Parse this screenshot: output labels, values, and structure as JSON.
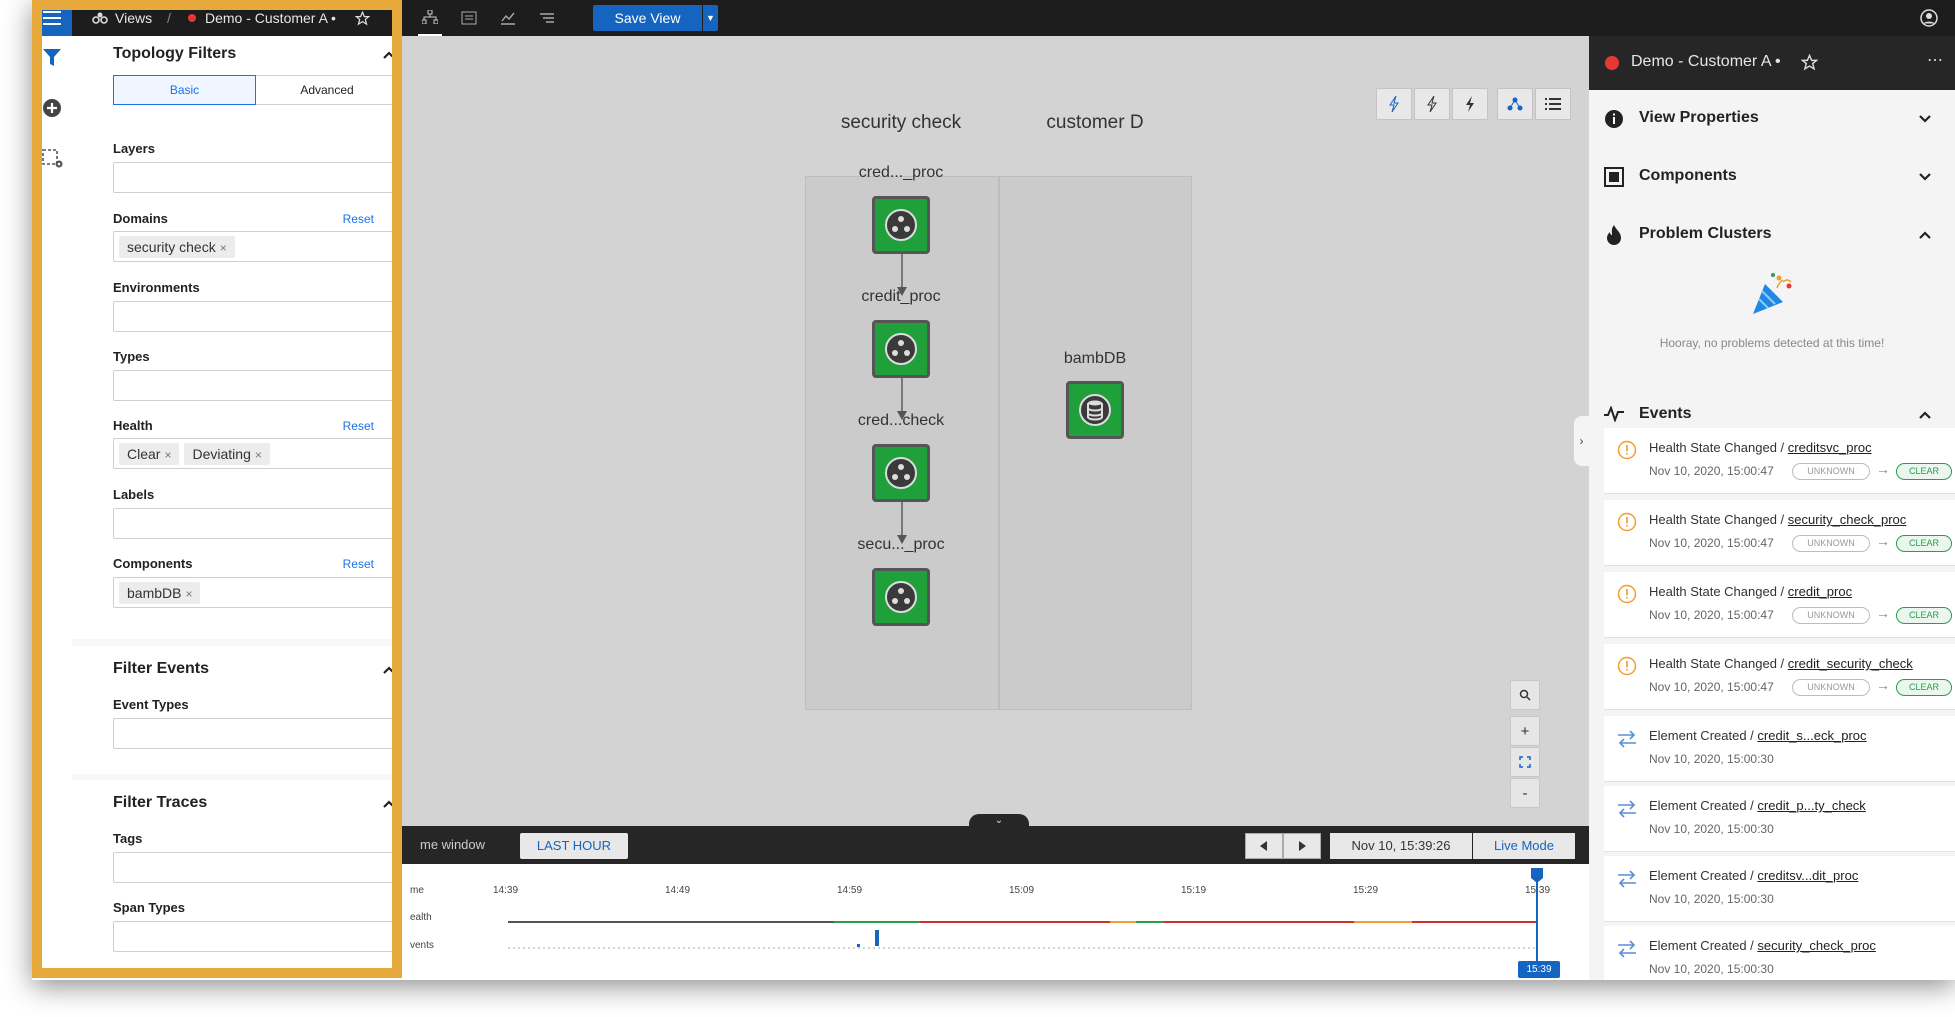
{
  "topbar": {
    "menu_icon": "hamburger-icon",
    "views_label": "Views",
    "separator": "/",
    "view_title": "Demo - Customer A •",
    "save_view_label": "Save View",
    "status_color": "#e53935"
  },
  "filters": {
    "title": "Topology Filters",
    "tabs": [
      {
        "label": "Basic"
      },
      {
        "label": "Advanced"
      }
    ],
    "layers_label": "Layers",
    "domains_label": "Domains",
    "domains_reset": "Reset",
    "domains_chips": [
      {
        "label": "security check"
      }
    ],
    "environments_label": "Environments",
    "types_label": "Types",
    "health_label": "Health",
    "health_reset": "Reset",
    "health_chips": [
      {
        "label": "Clear"
      },
      {
        "label": "Deviating"
      }
    ],
    "labels_label": "Labels",
    "components_label": "Components",
    "components_reset": "Reset",
    "components_chips": [
      {
        "label": "bambDB"
      }
    ],
    "filter_events_title": "Filter Events",
    "event_types_label": "Event Types",
    "filter_traces_title": "Filter Traces",
    "tags_label": "Tags",
    "span_types_label": "Span Types",
    "chip_remove": "×"
  },
  "topology": {
    "lanes": [
      {
        "title": "security check"
      },
      {
        "title": "customer D"
      }
    ],
    "nodes": [
      {
        "label": "cred..._proc"
      },
      {
        "label": "credit_proc"
      },
      {
        "label": "cred...check"
      },
      {
        "label": "secu..._proc"
      },
      {
        "label": "bambDB"
      }
    ],
    "node_color": "#1fa03b"
  },
  "zoom": {
    "plus": "+",
    "minus": "-"
  },
  "timebar": {
    "window_label": "me window",
    "window_value": "LAST HOUR",
    "current_time": "Nov 10, 15:39:26",
    "live_mode": "Live Mode"
  },
  "timeline": {
    "row_labels": [
      "me",
      "ealth",
      "vents"
    ],
    "ticks": [
      "14:39",
      "14:49",
      "14:59",
      "15:09",
      "15:19",
      "15:29",
      "15:39"
    ],
    "cursor_label": "15:39"
  },
  "right_panel": {
    "title": "Demo - Customer A •",
    "sections": [
      {
        "title": "View Properties"
      },
      {
        "title": "Components"
      },
      {
        "title": "Problem Clusters"
      }
    ],
    "no_problems": "Hooray, no problems detected at this time!",
    "events_title": "Events",
    "events": [
      {
        "type": "Health State Changed",
        "sep": " / ",
        "target": "creditsvc_proc",
        "time": "Nov 10, 2020, 15:00:47",
        "from": "UNKNOWN",
        "to": "CLEAR"
      },
      {
        "type": "Health State Changed",
        "sep": " / ",
        "target": "security_check_proc",
        "time": "Nov 10, 2020, 15:00:47",
        "from": "UNKNOWN",
        "to": "CLEAR"
      },
      {
        "type": "Health State Changed",
        "sep": " / ",
        "target": "credit_proc",
        "time": "Nov 10, 2020, 15:00:47",
        "from": "UNKNOWN",
        "to": "CLEAR"
      },
      {
        "type": "Health State Changed",
        "sep": " / ",
        "target": "credit_security_check",
        "time": "Nov 10, 2020, 15:00:47",
        "from": "UNKNOWN",
        "to": "CLEAR"
      },
      {
        "type": "Element Created",
        "sep": " / ",
        "target": "credit_s...eck_proc",
        "time": "Nov 10, 2020, 15:00:30"
      },
      {
        "type": "Element Created",
        "sep": " / ",
        "target": "credit_p...ty_check",
        "time": "Nov 10, 2020, 15:00:30"
      },
      {
        "type": "Element Created",
        "sep": " / ",
        "target": "creditsv...dit_proc",
        "time": "Nov 10, 2020, 15:00:30"
      },
      {
        "type": "Element Created",
        "sep": " / ",
        "target": "security_check_proc",
        "time": "Nov 10, 2020, 15:00:30"
      }
    ],
    "transition_arrow": "→"
  },
  "colors": {
    "accent": "#1565c0",
    "link": "#1a73e8",
    "highlight": "#e8a93c",
    "health_clear": "#2e9c4c",
    "health_red": "#d32f2f",
    "health_orange": "#f0a030"
  }
}
